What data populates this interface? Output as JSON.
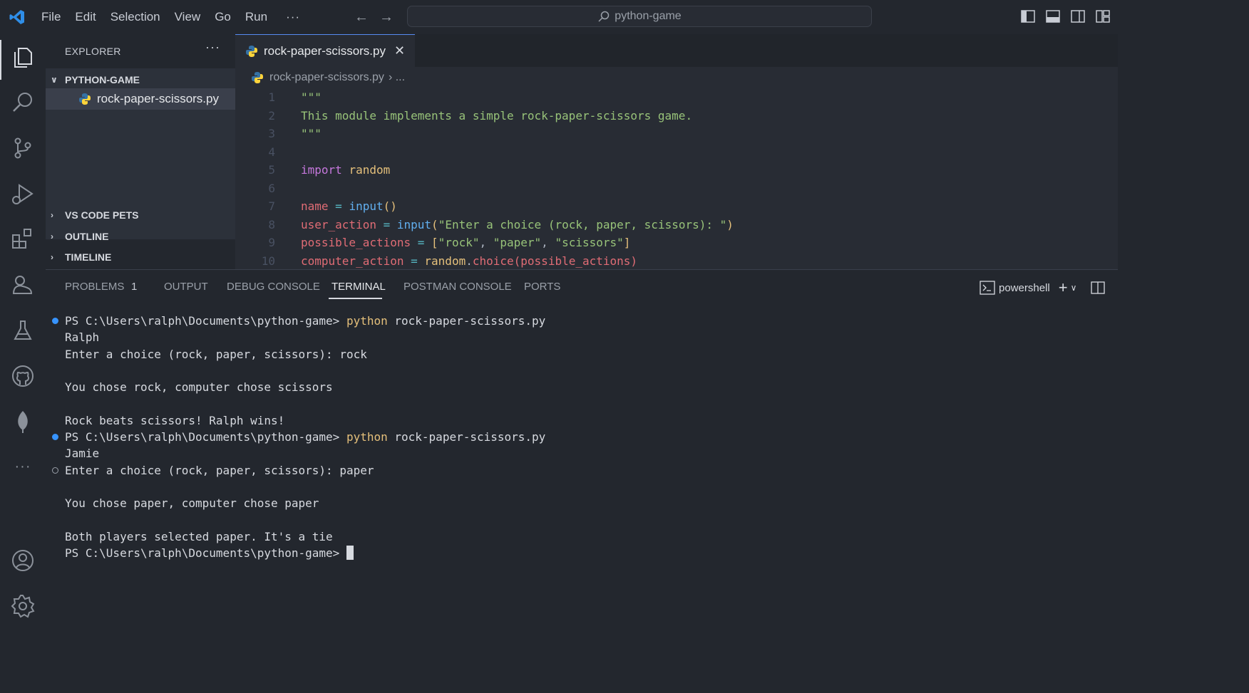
{
  "menu": [
    "File",
    "Edit",
    "Selection",
    "View",
    "Go",
    "Run"
  ],
  "menu_more": "···",
  "search": {
    "text": "python-game"
  },
  "sidebar": {
    "header": "EXPLORER",
    "more": "···",
    "folder": "PYTHON-GAME",
    "file": "rock-paper-scissors.py",
    "sections": [
      "VS CODE PETS",
      "OUTLINE",
      "TIMELINE"
    ]
  },
  "editor": {
    "tab_label": "rock-paper-scissors.py",
    "breadcrumb_file": "rock-paper-scissors.py",
    "breadcrumb_rest": "› ...",
    "lines": [
      {
        "n": "1",
        "tokens": [
          {
            "t": "\"\"\"",
            "c": "doc"
          }
        ]
      },
      {
        "n": "2",
        "tokens": [
          {
            "t": "This module implements a simple rock-paper-scissors game.",
            "c": "doc"
          }
        ]
      },
      {
        "n": "3",
        "tokens": [
          {
            "t": "\"\"\"",
            "c": "doc"
          }
        ]
      },
      {
        "n": "4",
        "tokens": []
      },
      {
        "n": "5",
        "tokens": [
          {
            "t": "import",
            "c": "kw"
          },
          {
            "t": " ",
            "c": "pl"
          },
          {
            "t": "random",
            "c": "mod"
          }
        ]
      },
      {
        "n": "6",
        "tokens": []
      },
      {
        "n": "7",
        "tokens": [
          {
            "t": "name",
            "c": "var"
          },
          {
            "t": " = ",
            "c": "op"
          },
          {
            "t": "input",
            "c": "fn"
          },
          {
            "t": "()",
            "c": "mod"
          }
        ]
      },
      {
        "n": "8",
        "tokens": [
          {
            "t": "user_action",
            "c": "var"
          },
          {
            "t": " = ",
            "c": "op"
          },
          {
            "t": "input",
            "c": "fn"
          },
          {
            "t": "(",
            "c": "mod"
          },
          {
            "t": "\"Enter a choice (rock, paper, scissors): \"",
            "c": "str"
          },
          {
            "t": ")",
            "c": "mod"
          }
        ]
      },
      {
        "n": "9",
        "tokens": [
          {
            "t": "possible_actions",
            "c": "var"
          },
          {
            "t": " = ",
            "c": "op"
          },
          {
            "t": "[",
            "c": "mod"
          },
          {
            "t": "\"rock\"",
            "c": "str"
          },
          {
            "t": ", ",
            "c": "pl"
          },
          {
            "t": "\"paper\"",
            "c": "str"
          },
          {
            "t": ", ",
            "c": "pl"
          },
          {
            "t": "\"scissors\"",
            "c": "str"
          },
          {
            "t": "]",
            "c": "mod"
          }
        ]
      },
      {
        "n": "10",
        "tokens": [
          {
            "t": "computer_action",
            "c": "var"
          },
          {
            "t": " = ",
            "c": "op"
          },
          {
            "t": "random",
            "c": "mod"
          },
          {
            "t": ".",
            "c": "pl"
          },
          {
            "t": "choice",
            "c": "var"
          },
          {
            "t": "(",
            "c": "var"
          },
          {
            "t": "possible_actions",
            "c": "var"
          },
          {
            "t": ")",
            "c": "var"
          }
        ]
      }
    ]
  },
  "panel": {
    "tabs": [
      "PROBLEMS",
      "OUTPUT",
      "DEBUG CONSOLE",
      "TERMINAL",
      "POSTMAN CONSOLE",
      "PORTS"
    ],
    "active_tab": "TERMINAL",
    "problems_count": "1",
    "shell": "powershell"
  },
  "terminal": {
    "lines": [
      {
        "dot": "filled",
        "prompt": "PS C:\\Users\\ralph\\Documents\\python-game> ",
        "cmd": "python",
        "args": " rock-paper-scissors.py"
      },
      {
        "text": "Ralph"
      },
      {
        "text": "Enter a choice (rock, paper, scissors): rock"
      },
      {
        "text": ""
      },
      {
        "text": "You chose rock, computer chose scissors"
      },
      {
        "text": ""
      },
      {
        "text": "Rock beats scissors! Ralph wins!"
      },
      {
        "dot": "filled",
        "prompt": "PS C:\\Users\\ralph\\Documents\\python-game> ",
        "cmd": "python",
        "args": " rock-paper-scissors.py"
      },
      {
        "text": "Jamie"
      },
      {
        "dot": "hollow",
        "text": "Enter a choice (rock, paper, scissors): paper"
      },
      {
        "text": ""
      },
      {
        "text": "You chose paper, computer chose paper"
      },
      {
        "text": ""
      },
      {
        "text": "Both players selected paper. It's a tie"
      },
      {
        "prompt": "PS C:\\Users\\ralph\\Documents\\python-game> ",
        "cursor": true
      }
    ]
  },
  "colors": {
    "accent": "#3794ff",
    "python_cmd": "#e5c07b",
    "string": "#98c379",
    "keyword": "#c678dd",
    "variable": "#e06c75",
    "function": "#61afef"
  }
}
